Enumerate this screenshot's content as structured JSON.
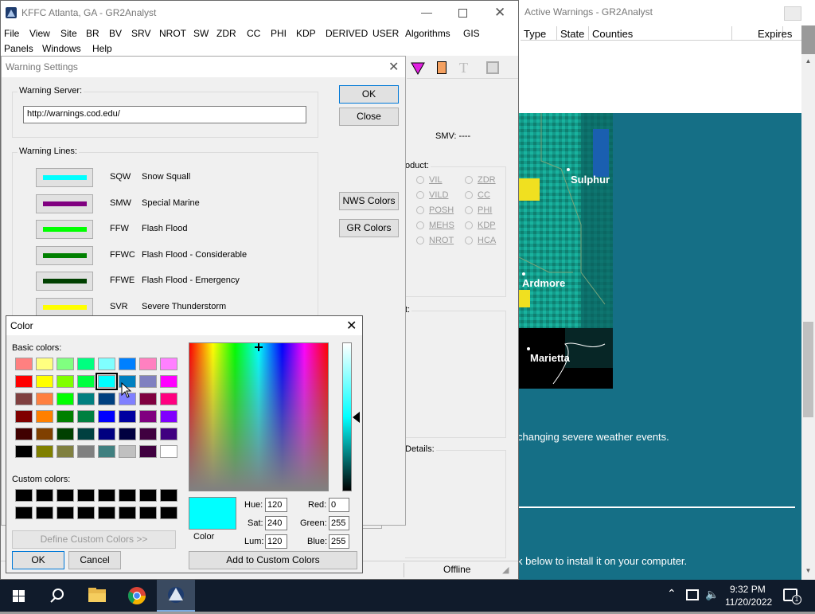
{
  "main_window": {
    "title": "KFFC Atlanta, GA - GR2Analyst",
    "menu_row1": [
      "File",
      "View",
      "Site",
      "BR",
      "BV",
      "SRV",
      "NROT",
      "SW",
      "ZDR",
      "CC",
      "PHI",
      "KDP",
      "DERIVED",
      "USER",
      "Algorithms",
      "GIS"
    ],
    "menu_row2": [
      "Panels",
      "Windows",
      "Help"
    ],
    "smv_label": "SMV: ----",
    "product_label": "oduct:",
    "products_col1": [
      "VIL",
      "VILD",
      "POSH",
      "MEHS",
      "NROT"
    ],
    "products_col2": [
      "ZDR",
      "CC",
      "PHI",
      "KDP",
      "HCA"
    ],
    "t_label": "t:",
    "details_label": "Details:",
    "status_text": "Offline"
  },
  "active_warnings": {
    "title": "Active Warnings - GR2Analyst",
    "columns": [
      "Type",
      "State",
      "Counties",
      "Expires"
    ]
  },
  "radar": {
    "cities": [
      "Sulphur",
      "Ardmore",
      "Marietta"
    ]
  },
  "web_content": {
    "line1": "changing severe weather events.",
    "line2": "k below to install it on your computer."
  },
  "warning_settings": {
    "title": "Warning Settings",
    "server_label": "Warning Server:",
    "server_value": "http://warnings.cod.edu/",
    "ok_label": "OK",
    "close_label": "Close",
    "lines_label": "Warning Lines:",
    "nws_colors_label": "NWS Colors",
    "gr_colors_label": "GR Colors",
    "lines": [
      {
        "code": "SQW",
        "name": "Snow Squall",
        "color": "#00ffff"
      },
      {
        "code": "SMW",
        "name": "Special Marine",
        "color": "#800080"
      },
      {
        "code": "FFW",
        "name": "Flash Flood",
        "color": "#00ff00"
      },
      {
        "code": "FFWC",
        "name": "Flash Flood - Considerable",
        "color": "#008000"
      },
      {
        "code": "FFWE",
        "name": "Flash Flood - Emergency",
        "color": "#004000"
      },
      {
        "code": "SVR",
        "name": "Severe Thunderstorm",
        "color": "#ffff00"
      }
    ]
  },
  "color_dialog": {
    "title": "Color",
    "basic_label": "Basic colors:",
    "custom_label": "Custom colors:",
    "define_label": "Define Custom Colors >>",
    "ok_label": "OK",
    "cancel_label": "Cancel",
    "color_label": "Color",
    "add_label": "Add to Custom Colors",
    "hue_label": "Hue:",
    "hue": "120",
    "sat_label": "Sat:",
    "sat": "240",
    "lum_label": "Lum:",
    "lum": "120",
    "red_label": "Red:",
    "red": "0",
    "green_label": "Green:",
    "green": "255",
    "blue_label": "Blue:",
    "blue": "255",
    "selected_color": "#00ffff",
    "basic_colors": [
      [
        "#ff8080",
        "#ffff80",
        "#80ff80",
        "#00ff80",
        "#80ffff",
        "#0080ff",
        "#ff80c0",
        "#ff80ff"
      ],
      [
        "#ff0000",
        "#ffff00",
        "#80ff00",
        "#00ff40",
        "#00ffff",
        "#0080c0",
        "#8080c0",
        "#ff00ff"
      ],
      [
        "#804040",
        "#ff8040",
        "#00ff00",
        "#008080",
        "#004080",
        "#8080ff",
        "#800040",
        "#ff0080"
      ],
      [
        "#800000",
        "#ff8000",
        "#008000",
        "#008040",
        "#0000ff",
        "#0000a0",
        "#800080",
        "#8000ff"
      ],
      [
        "#400000",
        "#804000",
        "#004000",
        "#004040",
        "#000080",
        "#000040",
        "#400040",
        "#400080"
      ],
      [
        "#000000",
        "#808000",
        "#808040",
        "#808080",
        "#408080",
        "#c0c0c0",
        "#400040",
        "#ffffff"
      ]
    ],
    "custom_colors": [
      [
        "#000000",
        "#000000",
        "#000000",
        "#000000",
        "#000000",
        "#000000",
        "#000000",
        "#000000"
      ],
      [
        "#000000",
        "#000000",
        "#000000",
        "#000000",
        "#000000",
        "#000000",
        "#000000",
        "#000000"
      ]
    ]
  },
  "taskbar": {
    "time": "9:32 PM",
    "date": "11/20/2022",
    "notification_count": "1"
  }
}
